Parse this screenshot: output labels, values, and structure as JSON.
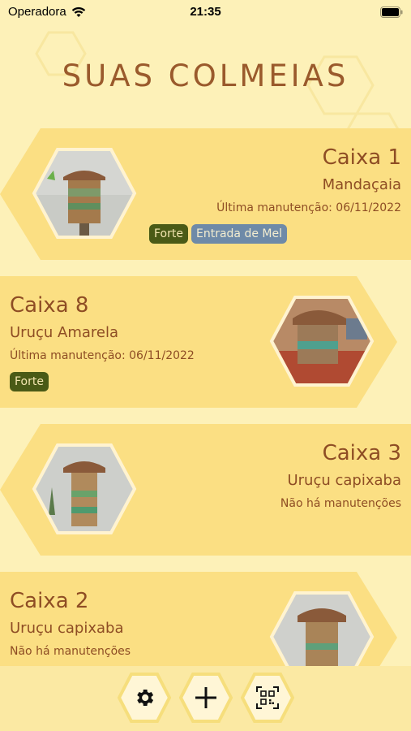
{
  "status_bar": {
    "carrier": "Operadora",
    "time": "21:35"
  },
  "page": {
    "title": "SUAS COLMEIAS"
  },
  "hives": [
    {
      "name": "Caixa 1",
      "species": "Mandaçaia",
      "maintenance": "Última manutenção: 06/11/2022",
      "tags": [
        "Forte",
        "Entrada de Mel"
      ],
      "photo_side": "left"
    },
    {
      "name": "Caixa 8",
      "species": "Uruçu Amarela",
      "maintenance": "Última manutenção: 06/11/2022",
      "tags": [
        "Forte"
      ],
      "photo_side": "right"
    },
    {
      "name": "Caixa 3",
      "species": "Uruçu capixaba",
      "maintenance": "Não há manutenções",
      "tags": [],
      "photo_side": "left"
    },
    {
      "name": "Caixa 2",
      "species": "Uruçu capixaba",
      "maintenance": "Não há manutenções",
      "tags": [],
      "photo_side": "right"
    }
  ],
  "bottom_nav": {
    "items": [
      {
        "icon": "gear-icon"
      },
      {
        "icon": "plus-icon"
      },
      {
        "icon": "qr-code-icon"
      }
    ]
  },
  "colors": {
    "background": "#fdf1b8",
    "card": "#fbdf83",
    "title": "#9a5a2c",
    "tag_forte": "#4a5a16",
    "tag_mel": "#6e8aa8"
  }
}
